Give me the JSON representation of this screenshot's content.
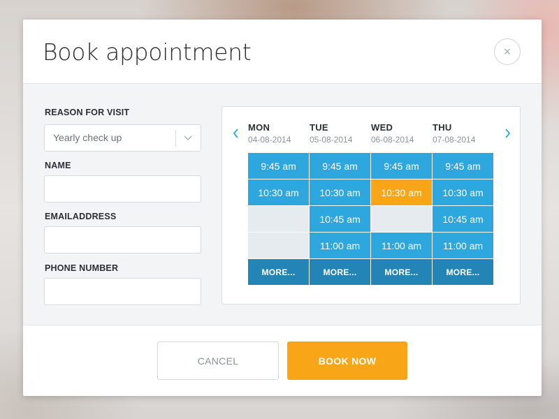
{
  "dialog": {
    "title": "Book appointment",
    "close_symbol": "×"
  },
  "form": {
    "reason": {
      "label": "REASON FOR VISIT",
      "value": "Yearly check up"
    },
    "name": {
      "label": "NAME",
      "value": ""
    },
    "email": {
      "label": "EMAILADDRESS",
      "value": ""
    },
    "phone": {
      "label": "PHONE NUMBER",
      "value": ""
    }
  },
  "calendar": {
    "days": [
      {
        "name": "MON",
        "date": "04-08-2014"
      },
      {
        "name": "TUE",
        "date": "05-08-2014"
      },
      {
        "name": "WED",
        "date": "06-08-2014"
      },
      {
        "name": "THU",
        "date": "07-08-2014"
      }
    ],
    "slots": [
      [
        "9:45 am",
        "10:30 am",
        "",
        ""
      ],
      [
        "9:45 am",
        "10:30 am",
        "10:45 am",
        "11:00 am"
      ],
      [
        "9:45 am",
        "10:30 am",
        "",
        "11:00 am"
      ],
      [
        "9:45 am",
        "10:30 am",
        "10:45 am",
        "11:00 am"
      ]
    ],
    "selected": {
      "day": 2,
      "slot": 1
    },
    "more_label": "MORE..."
  },
  "footer": {
    "cancel_label": "CANCEL",
    "book_label": "BOOK NOW"
  },
  "colors": {
    "accent": "#2ea7de",
    "accent_dark": "#2385b6",
    "selected": "#f8a518",
    "empty": "#e6ebef"
  }
}
